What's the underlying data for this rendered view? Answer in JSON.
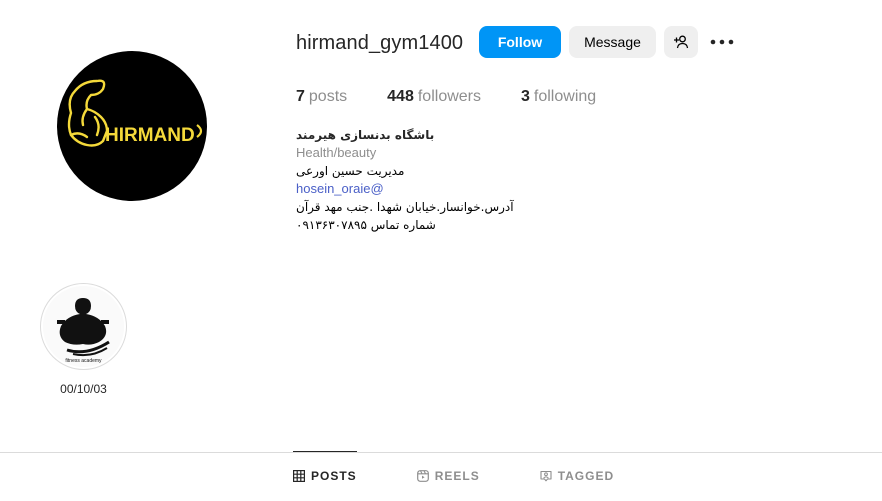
{
  "profile": {
    "username": "hirmand_gym1400",
    "logo_text": "HIRMAND",
    "follow_label": "Follow",
    "message_label": "Message",
    "colors": {
      "follow": "#0095f6",
      "logo_yellow": "#f4d93a"
    }
  },
  "stats": {
    "posts_count": "7",
    "posts_label": "posts",
    "followers_count": "448",
    "followers_label": "followers",
    "following_count": "3",
    "following_label": "following"
  },
  "bio": {
    "name": "باشگاه بدنسازی هیرمند",
    "category": "Health/beauty",
    "line1": "مدیریت حسین اورعی",
    "link": "hosein_oraie@",
    "line2": "آدرس.خوانسار.خیابان شهدا .جنب مهد قرآن",
    "line3": "شماره تماس ۰۹۱۳۶۳۰۷۸۹۵"
  },
  "highlights": [
    {
      "label": "00/10/03",
      "caption": "fitness academy"
    }
  ],
  "tabs": [
    {
      "label": "POSTS",
      "icon": "grid-icon"
    },
    {
      "label": "REELS",
      "icon": "reels-icon"
    },
    {
      "label": "TAGGED",
      "icon": "tagged-icon"
    }
  ]
}
